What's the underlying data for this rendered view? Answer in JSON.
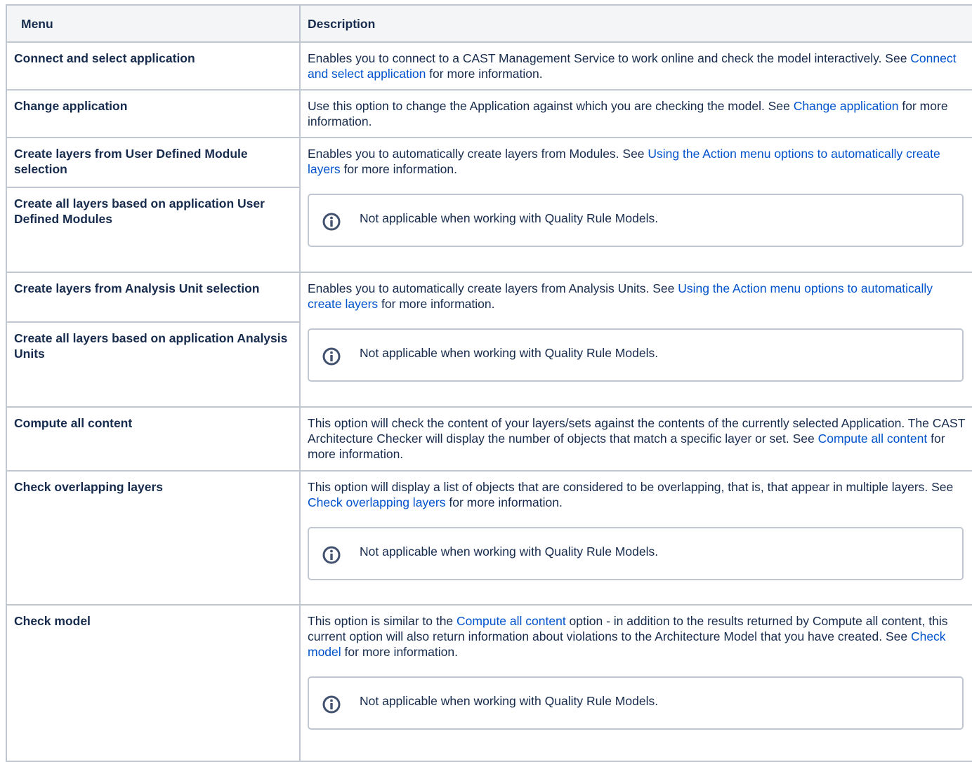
{
  "headers": {
    "menu": "Menu",
    "description": "Description"
  },
  "note_text": "Not applicable when working with Quality Rule Models.",
  "icon": "info-icon",
  "colors": {
    "link": "#0052cc",
    "border": "#c1c7d0",
    "header_bg": "#f4f5f7",
    "text": "#172b4d"
  },
  "rows": [
    {
      "menu": "Connect and select application",
      "desc": {
        "pre": "Enables you to connect to a CAST Management Service to work online and check the model interactively. See ",
        "link": "Connect and select application",
        "post": " for more information."
      }
    },
    {
      "menu": "Change application",
      "desc": {
        "pre": "Use this option to change the Application against which you are checking the model. See ",
        "link": "Change application",
        "post": " for more information."
      }
    },
    {
      "menu": "Create layers from User Defined Module selection",
      "menu2": "Create all layers based on application User Defined Modules",
      "desc": {
        "pre": "Enables you to automatically create layers from Modules. See ",
        "link": "Using the Action menu options to automatically create layers",
        "post": " for more information."
      }
    },
    {
      "menu": "Create layers from Analysis Unit selection",
      "menu2": "Create all layers based on application Analysis Units",
      "desc": {
        "pre": "Enables you to automatically create layers from Analysis Units. See ",
        "link": "Using the Action menu options to automatically create layers",
        "post": " for more information."
      }
    },
    {
      "menu": "Compute all content",
      "desc": {
        "pre": "This option will check the content of your layers/sets against the contents of the currently selected Application. The CAST Architecture Checker will display the number of objects that match a specific layer or set. See ",
        "link": "Compute all content",
        "post": " for more information."
      }
    },
    {
      "menu": "Check overlapping layers",
      "desc": {
        "pre": "This option will display a list of objects that are considered to be overlapping, that is, that appear in multiple layers. See ",
        "link": "Check overlapping layers",
        "post": " for more information."
      }
    },
    {
      "menu": "Check model",
      "desc": {
        "pre": "This option is similar to the ",
        "link": "Compute all content",
        "mid": " option - in addition to the results returned by Compute all content, this current option will also return information about violations to the Architecture Model that you have created. See ",
        "link2": "Check model",
        "post": " for more information."
      }
    }
  ]
}
